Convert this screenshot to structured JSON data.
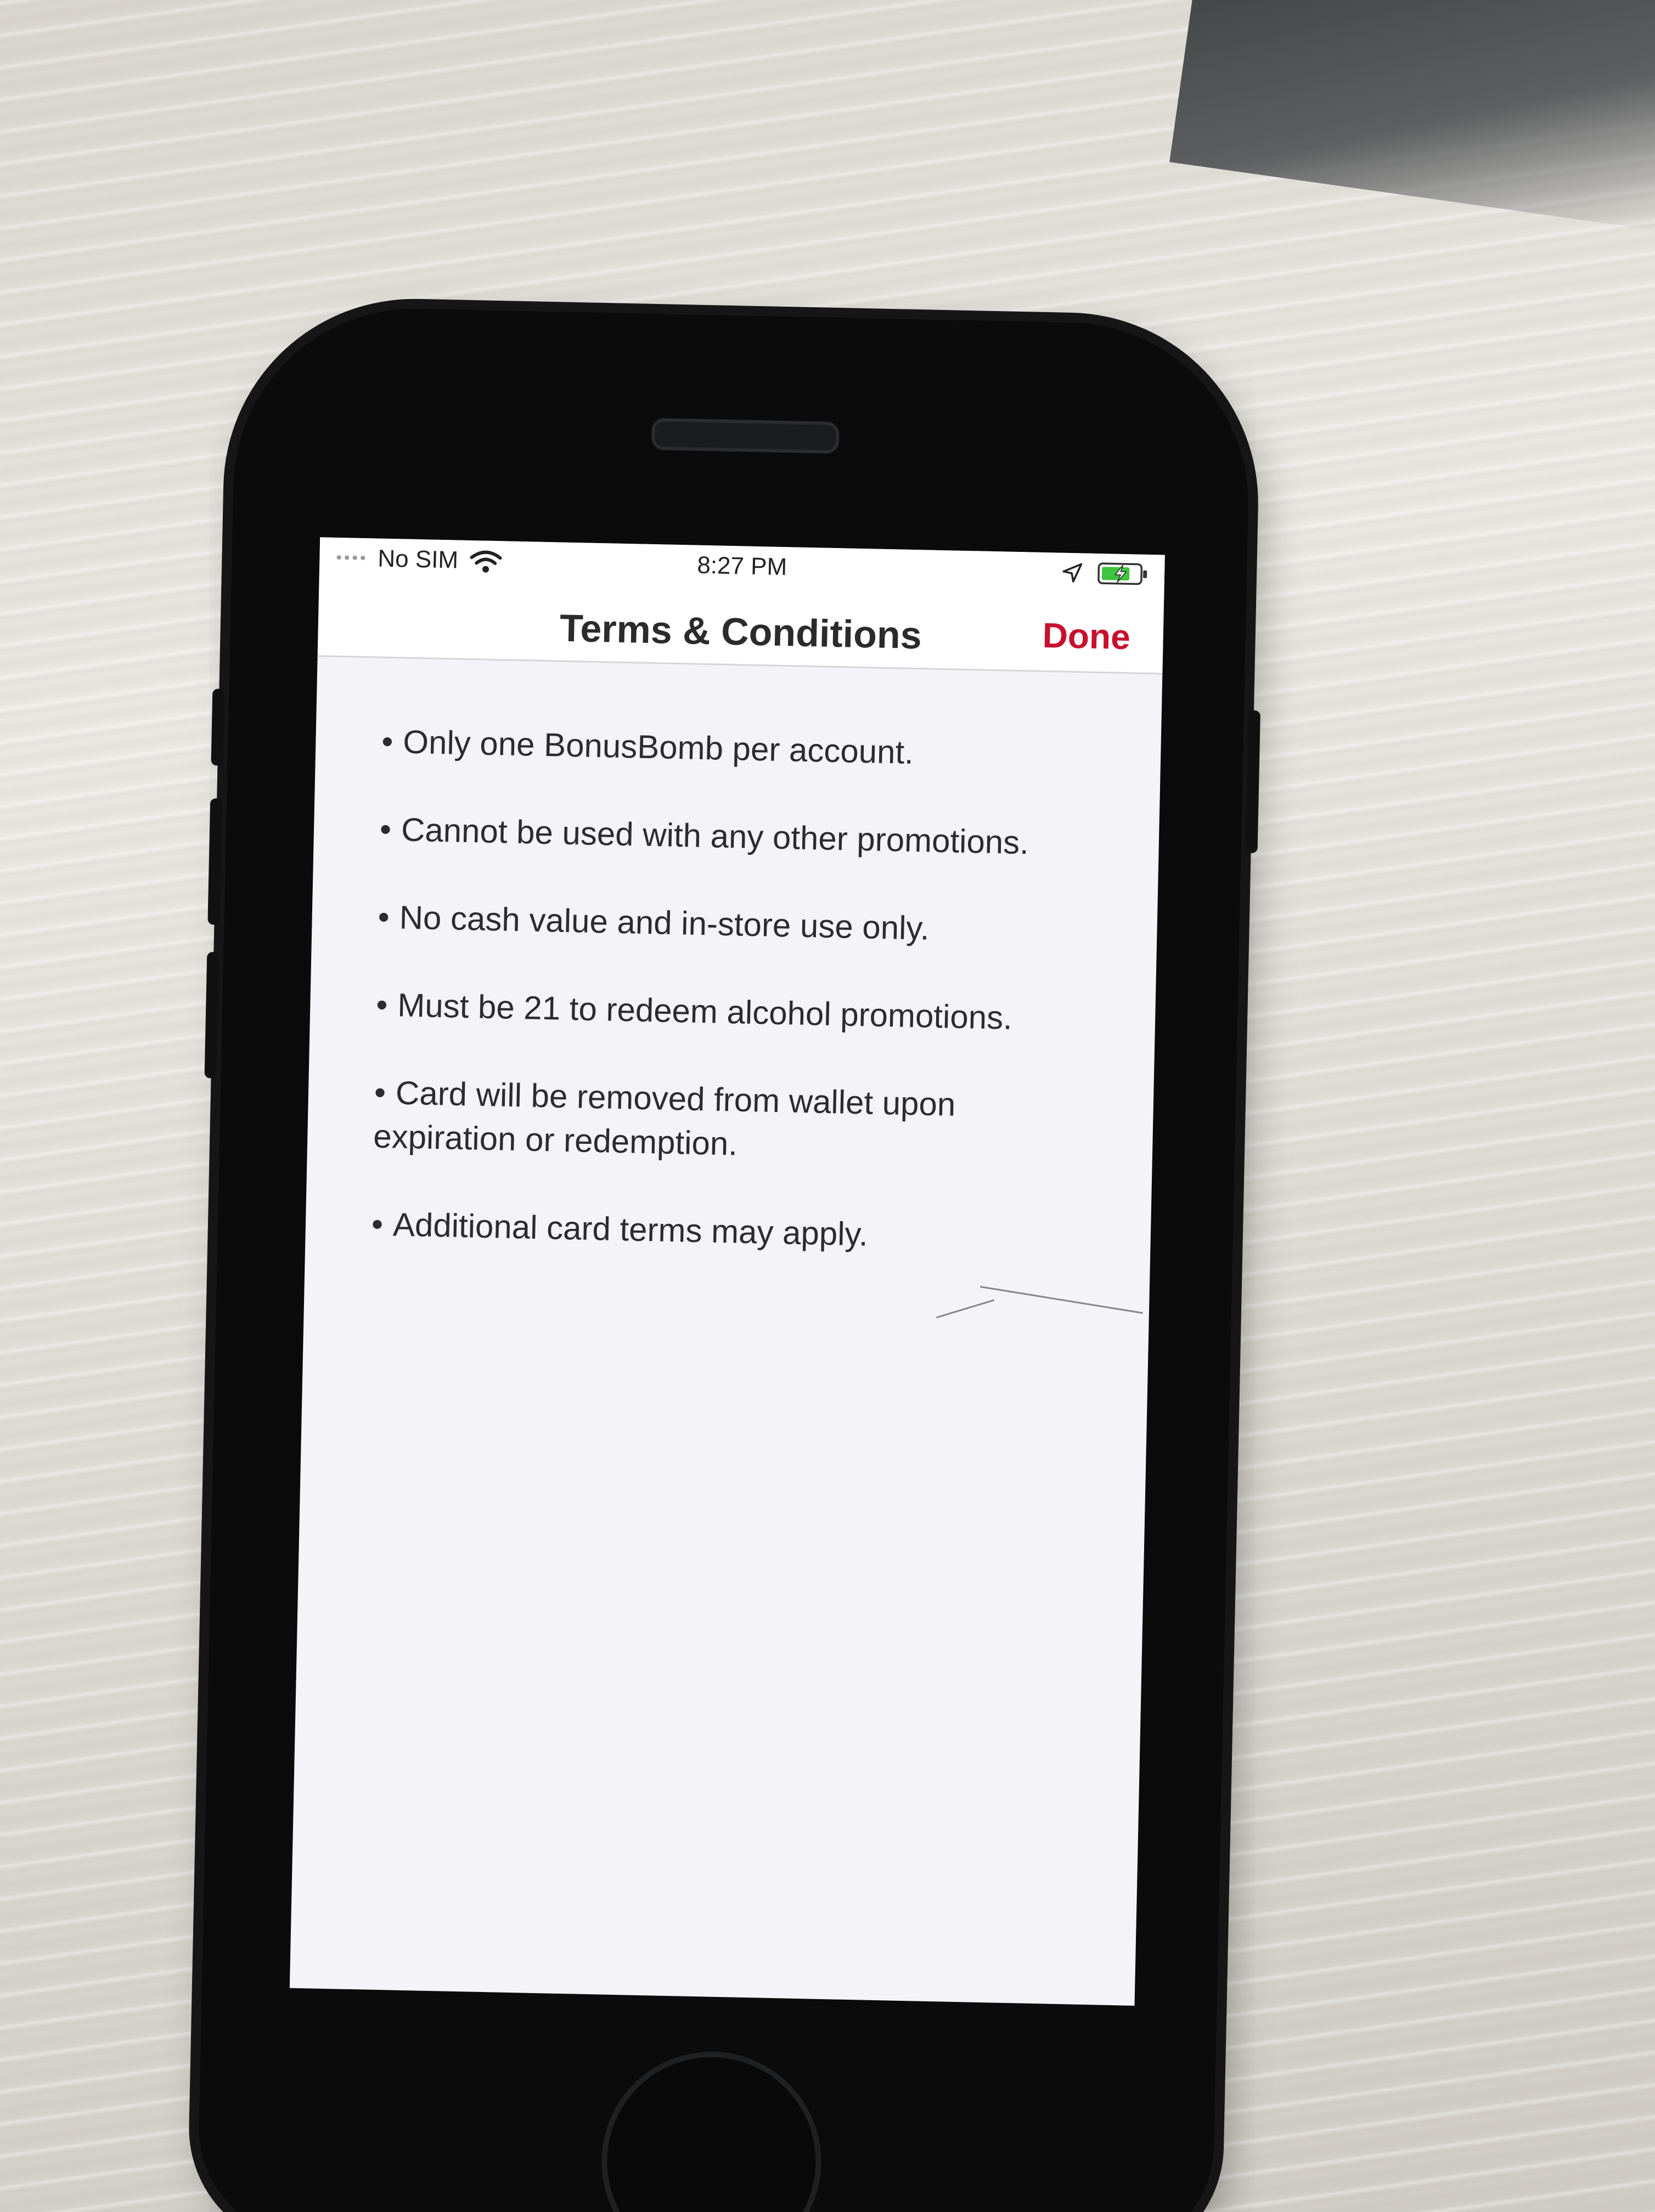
{
  "status_bar": {
    "carrier": "No SIM",
    "time": "8:27 PM",
    "icons": [
      "signal-dots-icon",
      "wifi-icon",
      "location-arrow-icon",
      "battery-charging-icon"
    ],
    "battery_color": "#3ec43e"
  },
  "nav": {
    "title": "Terms & Conditions",
    "done_label": "Done",
    "accent_color": "#c8102e"
  },
  "terms": [
    "Only one BonusBomb per account.",
    "Cannot be used with any other promotions.",
    "No cash value and in-store use only.",
    "Must be 21 to redeem alcohol promotions.",
    "Card will be removed from wallet upon expiration or redemption.",
    "Additional card terms may apply."
  ],
  "bullet_symbol": "•"
}
